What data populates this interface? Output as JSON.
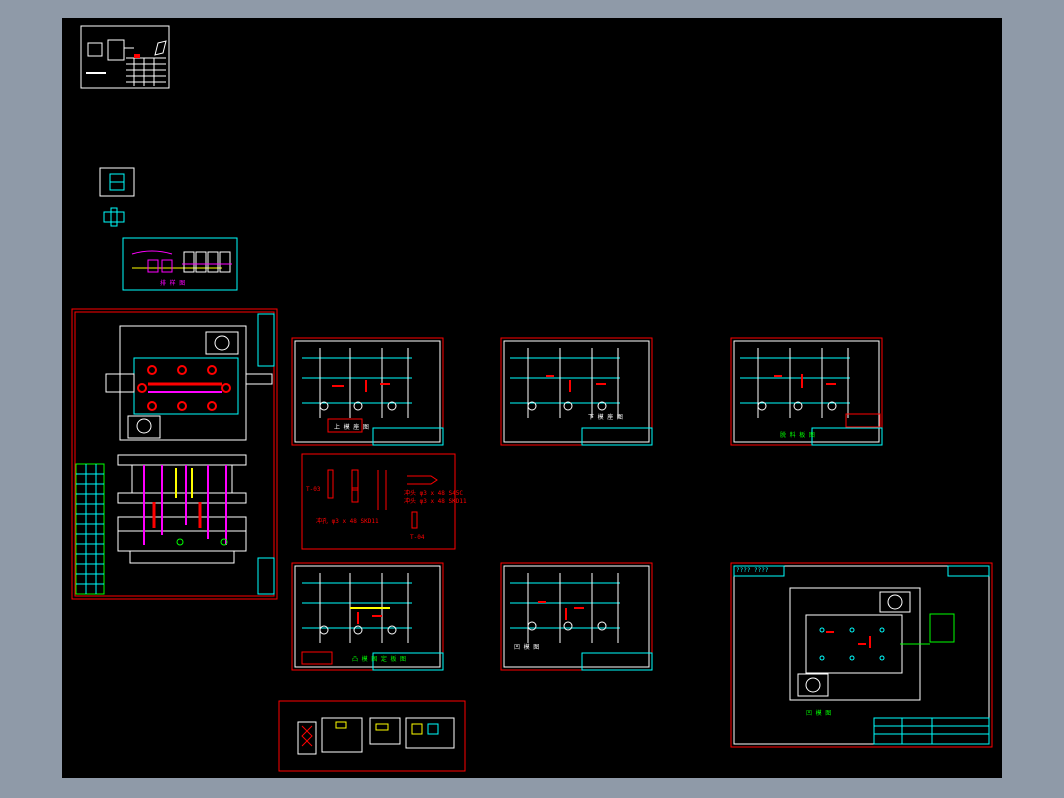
{
  "drawing_labels": {
    "strip_layout": "排 样 图",
    "plate1_title": "上 模 座 图",
    "plate2_title": "下 模 座 图",
    "plate3_title": "脱 料 板 图",
    "plate4_title": "凸 模 固 定 板 图",
    "plate5_title": "凹 模 图",
    "big_plate_title": "凹 模 图",
    "big_plate_header": "???? ????",
    "parts_note1": "冲头 φ3 x 48 S45C",
    "parts_note2": "冲头 φ3 x 48 SKD11",
    "parts_note3": "冲孔 φ3 x 48 SKD11",
    "parts_tag1": "T-03",
    "parts_tag2": "T-04"
  },
  "colors": {
    "background": "#000000",
    "window_gray": "#8f9aa8",
    "border_red": "#ff0000",
    "line_cyan": "#00ffff",
    "line_white": "#ffffff",
    "line_green": "#00ff00",
    "line_magenta": "#ff00ff",
    "line_yellow": "#ffff00"
  }
}
